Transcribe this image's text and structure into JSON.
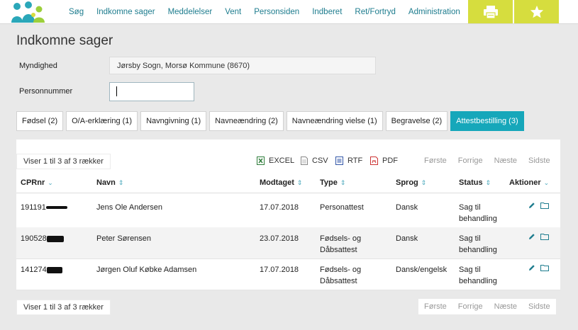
{
  "nav": {
    "items": [
      "Søg",
      "Indkomne sager",
      "Meddelelser",
      "Vent",
      "Personsiden",
      "Indberet",
      "Ret/Fortryd",
      "Administration"
    ]
  },
  "toolbar": {
    "print_icon": "printer-icon",
    "star_icon": "star-icon",
    "accent_color": "#d6dd3e"
  },
  "page": {
    "title": "Indkomne sager"
  },
  "form": {
    "myndighed_label": "Myndighed",
    "myndighed_value": "Jørsby Sogn, Morsø Kommune (8670)",
    "personnummer_label": "Personnummer",
    "personnummer_value": ""
  },
  "tabs": [
    {
      "label": "Fødsel (2)"
    },
    {
      "label": "O/A-erklæring (1)"
    },
    {
      "label": "Navngivning (1)"
    },
    {
      "label": "Navneændring (2)"
    },
    {
      "label": "Navneændring vielse (1)"
    },
    {
      "label": "Begravelse (2)"
    },
    {
      "label": "Attestbestilling (3)",
      "active": true
    }
  ],
  "table_info": {
    "count_text_top": "Viser 1 til 3 af 3 rækker",
    "count_text_bottom": "Viser 1 til 3 af 3 rækker"
  },
  "export": {
    "excel": "EXCEL",
    "csv": "CSV",
    "rtf": "RTF",
    "pdf": "PDF"
  },
  "pager": {
    "first": "Første",
    "prev": "Forrige",
    "next": "Næste",
    "last": "Sidste"
  },
  "columns": {
    "cpr": "CPRnr",
    "navn": "Navn",
    "modtaget": "Modtaget",
    "type": "Type",
    "sprog": "Sprog",
    "status": "Status",
    "aktioner": "Aktioner"
  },
  "rows": [
    {
      "cpr": "191191",
      "navn": "Jens Ole Andersen",
      "modtaget": "17.07.2018",
      "type_1": "Personattest",
      "type_2": "",
      "sprog": "Dansk",
      "status_1": "Sag til",
      "status_2": "behandling"
    },
    {
      "cpr": "190528",
      "navn": "Peter Sørensen",
      "modtaget": "23.07.2018",
      "type_1": "Fødsels- og",
      "type_2": "Dåbsattest",
      "sprog": "Dansk",
      "status_1": "Sag til",
      "status_2": "behandling"
    },
    {
      "cpr": "141274",
      "navn": "Jørgen Oluf Købke Adamsen",
      "modtaget": "17.07.2018",
      "type_1": "Fødsels- og",
      "type_2": "Dåbsattest",
      "sprog": "Dansk/engelsk",
      "status_1": "Sag til",
      "status_2": "behandling"
    }
  ],
  "colors": {
    "link": "#1d7c8e",
    "active_tab": "#16a7ba",
    "sort_icon": "#4aa8bc"
  }
}
